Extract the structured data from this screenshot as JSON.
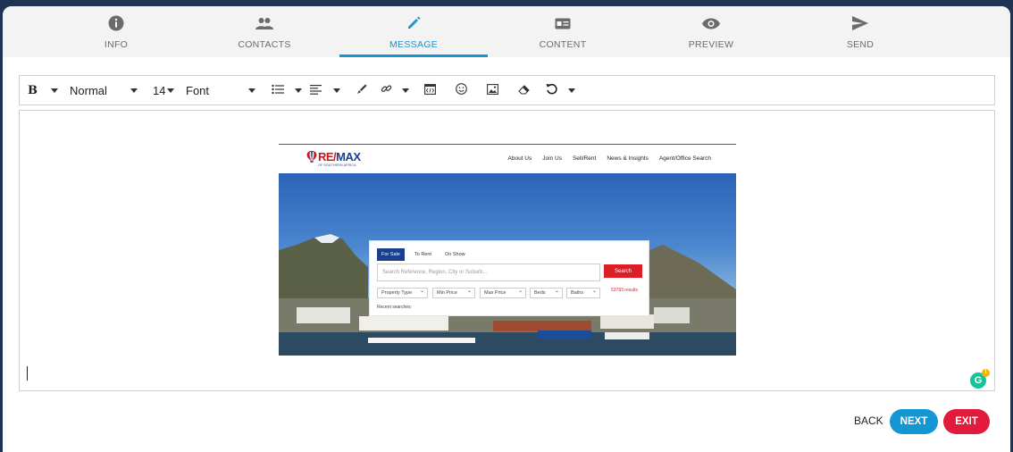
{
  "steps": [
    {
      "label": "INFO",
      "icon": "info-icon"
    },
    {
      "label": "CONTACTS",
      "icon": "people-icon"
    },
    {
      "label": "MESSAGE",
      "icon": "pencil-icon",
      "active": true
    },
    {
      "label": "CONTENT",
      "icon": "card-icon"
    },
    {
      "label": "PREVIEW",
      "icon": "eye-icon"
    },
    {
      "label": "SEND",
      "icon": "send-icon"
    }
  ],
  "toolbar": {
    "bold": "B",
    "paragraph_style": "Normal",
    "font_size": "14",
    "font_family": "Font"
  },
  "embed": {
    "logo_re": "RE/",
    "logo_max": "MAX",
    "logo_sub": "OF SOUTHERN AFRICA",
    "nav": [
      "About Us",
      "Join Us",
      "Sell/Rent",
      "News & Insights",
      "Agent/Office Search"
    ],
    "tabs": [
      "For Sale",
      "To Rent",
      "On Show"
    ],
    "search_placeholder": "Search Reference, Region, City or Suburb...",
    "search_button": "Search",
    "results": "53783 results",
    "filters": [
      "Property Type",
      "Min Price",
      "Max Price",
      "Beds",
      "Baths"
    ],
    "recent": "Recent searches:"
  },
  "footer": {
    "back": "BACK",
    "next": "NEXT",
    "exit": "EXIT"
  },
  "colors": {
    "accent": "#1496d2",
    "exit": "#e21b3c",
    "header_bg": "#1f3452"
  }
}
